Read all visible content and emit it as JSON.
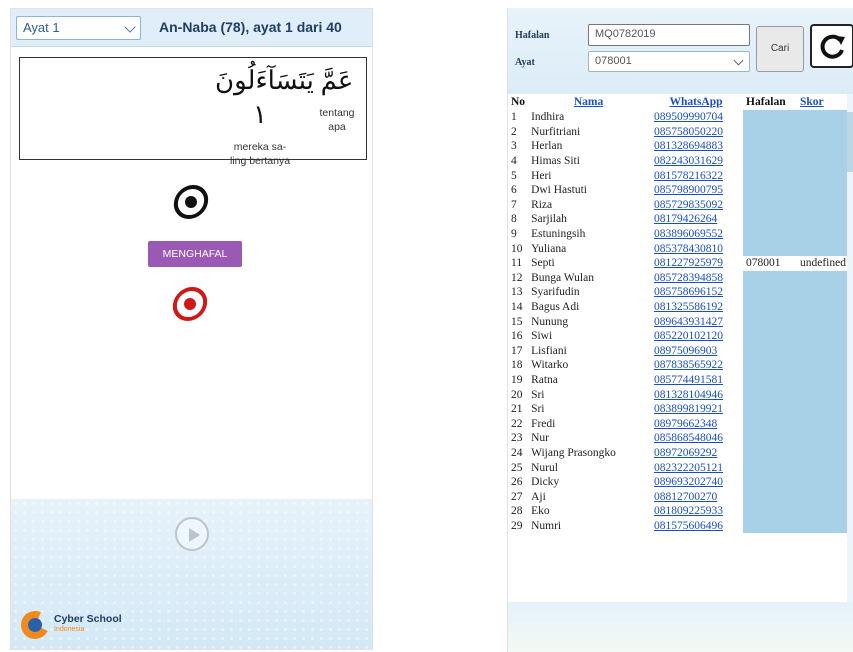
{
  "left_app": {
    "ayat_select": {
      "value": "Ayat 1"
    },
    "surah_title": "An-Naba (78), ayat 1 dari 40",
    "verse": {
      "words": [
        {
          "arabic": "عَمَّ",
          "translation_line1": "tentang",
          "translation_line2": "apa"
        },
        {
          "arabic": "يَتَسَآءَلُونَ ۱",
          "translation_line1": "mereka sa-",
          "translation_line2": "ling bertanya"
        }
      ]
    },
    "menghafal_button": "MENGHAFAL",
    "logo": {
      "name": "Cyber School",
      "subtitle": "Indonesia"
    },
    "colors": {
      "button": "#9b59b6",
      "record_active": "#d01818",
      "record_idle": "#111111",
      "header_bg": "#dfeef8"
    },
    "icons": {
      "listen": "listen-circle-icon",
      "record": "record-circle-icon",
      "play": "play-icon"
    }
  },
  "right_app": {
    "form": {
      "hafalan_label": "Hafalan",
      "hafalan_value": "MQ0782019",
      "ayat_label": "Ayat",
      "ayat_value": "078001",
      "cari_button": "Cari",
      "refresh_icon": "refresh-icon"
    },
    "table": {
      "headers": {
        "no": "No",
        "nama": "Nama",
        "whatsapp": "WhatsApp",
        "hafalan": "Hafalan",
        "skor": "Skor"
      },
      "rows": [
        {
          "no": "1",
          "nama": "Indhira",
          "wa": "089509990704",
          "hafalan": "",
          "skor": ""
        },
        {
          "no": "2",
          "nama": "Nurfitriani",
          "wa": "085758050220",
          "hafalan": "",
          "skor": ""
        },
        {
          "no": "3",
          "nama": "Herlan",
          "wa": "081328694883",
          "hafalan": "",
          "skor": ""
        },
        {
          "no": "4",
          "nama": "Himas Siti",
          "wa": "082243031629",
          "hafalan": "",
          "skor": ""
        },
        {
          "no": "5",
          "nama": "Heri",
          "wa": "081578216322",
          "hafalan": "",
          "skor": ""
        },
        {
          "no": "6",
          "nama": "Dwi Hastuti",
          "wa": "085798900795",
          "hafalan": "",
          "skor": ""
        },
        {
          "no": "7",
          "nama": "Riza",
          "wa": "085729835092",
          "hafalan": "",
          "skor": ""
        },
        {
          "no": "8",
          "nama": "Sarjilah",
          "wa": "08179426264",
          "hafalan": "",
          "skor": ""
        },
        {
          "no": "9",
          "nama": "Estuningsih",
          "wa": "083896069552",
          "hafalan": "",
          "skor": ""
        },
        {
          "no": "10",
          "nama": "Yuliana",
          "wa": "085378430810",
          "hafalan": "",
          "skor": ""
        },
        {
          "no": "11",
          "nama": "Septi",
          "wa": "081227925979",
          "hafalan": "078001",
          "skor": "undefined"
        },
        {
          "no": "12",
          "nama": "Bunga Wulan",
          "wa": "085728394858",
          "hafalan": "",
          "skor": ""
        },
        {
          "no": "13",
          "nama": "Syarifudin",
          "wa": "085758696152",
          "hafalan": "",
          "skor": ""
        },
        {
          "no": "14",
          "nama": "Bagus Adi",
          "wa": "081325586192",
          "hafalan": "",
          "skor": ""
        },
        {
          "no": "15",
          "nama": "Nunung",
          "wa": "089643931427",
          "hafalan": "",
          "skor": ""
        },
        {
          "no": "16",
          "nama": "Siwi",
          "wa": "085220102120",
          "hafalan": "",
          "skor": ""
        },
        {
          "no": "17",
          "nama": "Lisfiani",
          "wa": "08975096903",
          "hafalan": "",
          "skor": ""
        },
        {
          "no": "18",
          "nama": "Witarko",
          "wa": "087838565922",
          "hafalan": "",
          "skor": ""
        },
        {
          "no": "19",
          "nama": "Ratna",
          "wa": "085774491581",
          "hafalan": "",
          "skor": ""
        },
        {
          "no": "20",
          "nama": "Sri",
          "wa": "081328104946",
          "hafalan": "",
          "skor": ""
        },
        {
          "no": "21",
          "nama": "Sri",
          "wa": "083899819921",
          "hafalan": "",
          "skor": ""
        },
        {
          "no": "22",
          "nama": "Fredi",
          "wa": "08979662348",
          "hafalan": "",
          "skor": ""
        },
        {
          "no": "23",
          "nama": "Nur",
          "wa": "085868548046",
          "hafalan": "",
          "skor": ""
        },
        {
          "no": "24",
          "nama": "Wijang Prasongko",
          "wa": "08972069292",
          "hafalan": "",
          "skor": ""
        },
        {
          "no": "25",
          "nama": "Nurul",
          "wa": "082322205121",
          "hafalan": "",
          "skor": ""
        },
        {
          "no": "26",
          "nama": "Dicky",
          "wa": "089693202740",
          "hafalan": "",
          "skor": ""
        },
        {
          "no": "27",
          "nama": "Aji",
          "wa": "08812700270",
          "hafalan": "",
          "skor": ""
        },
        {
          "no": "28",
          "nama": "Eko",
          "wa": "081809225933",
          "hafalan": "",
          "skor": ""
        },
        {
          "no": "29",
          "nama": "Numri",
          "wa": "081575606496",
          "hafalan": "",
          "skor": ""
        }
      ]
    }
  }
}
